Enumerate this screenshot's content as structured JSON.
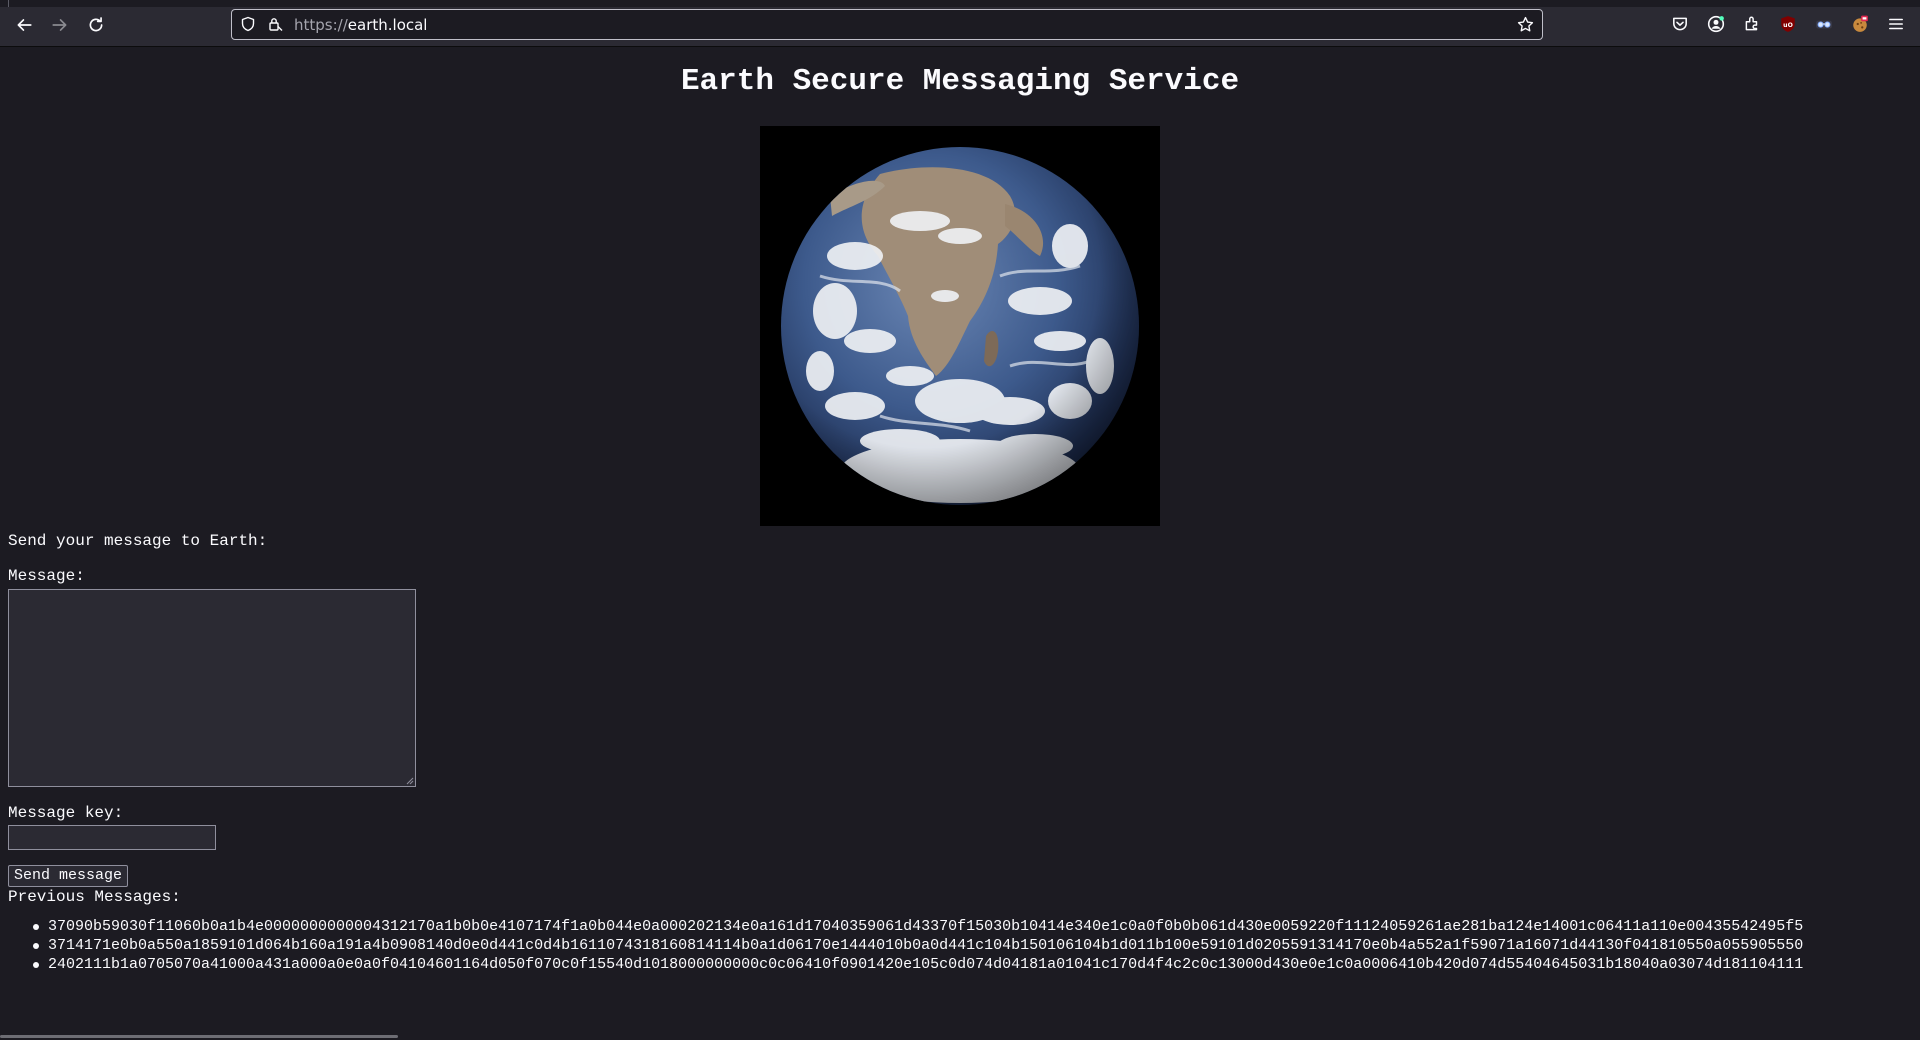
{
  "browser": {
    "url_scheme": "https://",
    "url_host": "earth.local",
    "icons": [
      "back-icon",
      "forward-icon",
      "reload-icon",
      "shield-icon",
      "lock-icon",
      "star-icon",
      "pocket-icon",
      "account-icon",
      "extensions-icon",
      "ublock-icon",
      "ext-glasses-icon",
      "ext-cookie-icon",
      "menu-icon"
    ]
  },
  "page": {
    "title": "Earth Secure Messaging Service",
    "send_prompt": "Send your message to Earth:",
    "message_label": "Message:",
    "message_value": "",
    "key_label": "Message key:",
    "key_value": "",
    "send_button": "Send message",
    "previous_label": "Previous Messages:",
    "messages": [
      "37090b59030f11060b0a1b4e0000000000004312170a1b0b0e4107174f1a0b044e0a000202134e0a161d17040359061d43370f15030b10414e340e1c0a0f0b0b061d430e0059220f11124059261ae281ba124e14001c06411a110e00435542495f5",
      "3714171e0b0a550a1859101d064b160a191a4b0908140d0e0d441c0d4b1611074318160814114b0a1d06170e1444010b0a0d441c104b150106104b1d011b100e59101d0205591314170e0b4a552a1f59071a16071d44130f041810550a055905550",
      "2402111b1a0705070a41000a431a000a0e0a0f04104601164d050f070c0f15540d1018000000000c0c06410f0901420e105c0d074d04181a01041c170d4f4c2c0c13000d430e0e1c0a0006410b420d074d55404645031b18040a03074d181104111"
    ]
  },
  "colors": {
    "page_bg": "#1c1b22",
    "chrome_bg": "#2b2a33",
    "text": "#fbfbfe",
    "field_bg": "#2b2a33",
    "field_border": "#8f8f9d"
  }
}
